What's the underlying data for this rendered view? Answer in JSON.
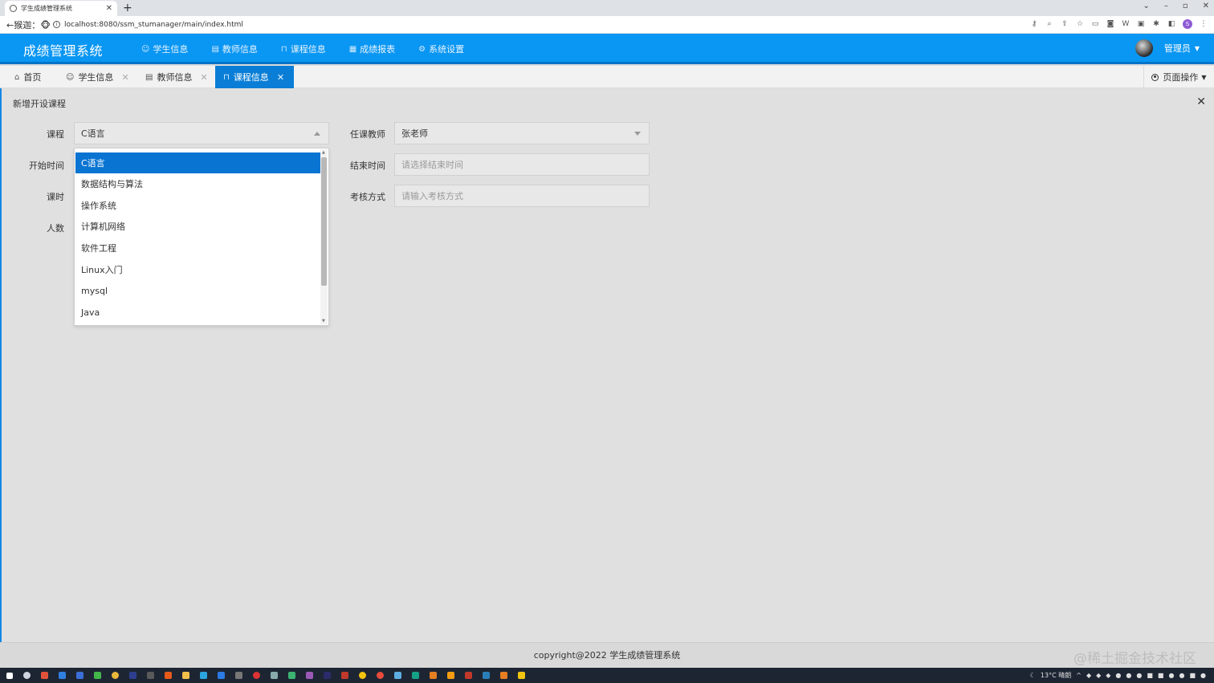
{
  "browser": {
    "tab_title": "学生成绩管理系统",
    "new_tab": "+",
    "back_label": "←猴迦：🐵",
    "url": "localhost:8080/ssm_stumanager/main/index.html",
    "win_min": "–",
    "win_max": "▫",
    "win_close": "✕",
    "profile_letter": "S"
  },
  "header": {
    "app_title": "成绩管理系统",
    "nav": [
      {
        "icon": "users-icon",
        "label": "学生信息"
      },
      {
        "icon": "document-icon",
        "label": "教师信息"
      },
      {
        "icon": "book-icon",
        "label": "课程信息"
      },
      {
        "icon": "table-icon",
        "label": "成绩报表"
      },
      {
        "icon": "gear-icon",
        "label": "系统设置"
      }
    ],
    "user_label": "管理员"
  },
  "tabs": [
    {
      "label": "首页",
      "closable": false,
      "active": false
    },
    {
      "label": "学生信息",
      "closable": true,
      "active": false
    },
    {
      "label": "教师信息",
      "closable": true,
      "active": false
    },
    {
      "label": "课程信息",
      "closable": true,
      "active": true
    }
  ],
  "page_ops_label": "页面操作",
  "dialog": {
    "title": "新增开设课程",
    "fields": {
      "course_label": "课程",
      "course_value": "C语言",
      "teacher_label": "任课教师",
      "teacher_value": "张老师",
      "start_label": "开始时间",
      "end_label": "结束时间",
      "end_placeholder": "请选择结束时间",
      "hours_label": "课时",
      "exam_label": "考核方式",
      "exam_placeholder": "请输入考核方式",
      "people_label": "人数"
    },
    "course_options": [
      "C语言",
      "数据结构与算法",
      "操作系统",
      "计算机网络",
      "软件工程",
      "Linux入门",
      "mysql",
      "Java"
    ],
    "selected_option": "C语言"
  },
  "footer": {
    "copyright": "copyright@2022 学生成绩管理系统",
    "watermark": "@稀土掘金技术社区"
  },
  "taskbar": {
    "weather": "13°C 晴朗"
  },
  "colors": {
    "header_bg": "#0a96f3",
    "active_tab": "#0a7ed6",
    "selected_option": "#0a74d2"
  }
}
